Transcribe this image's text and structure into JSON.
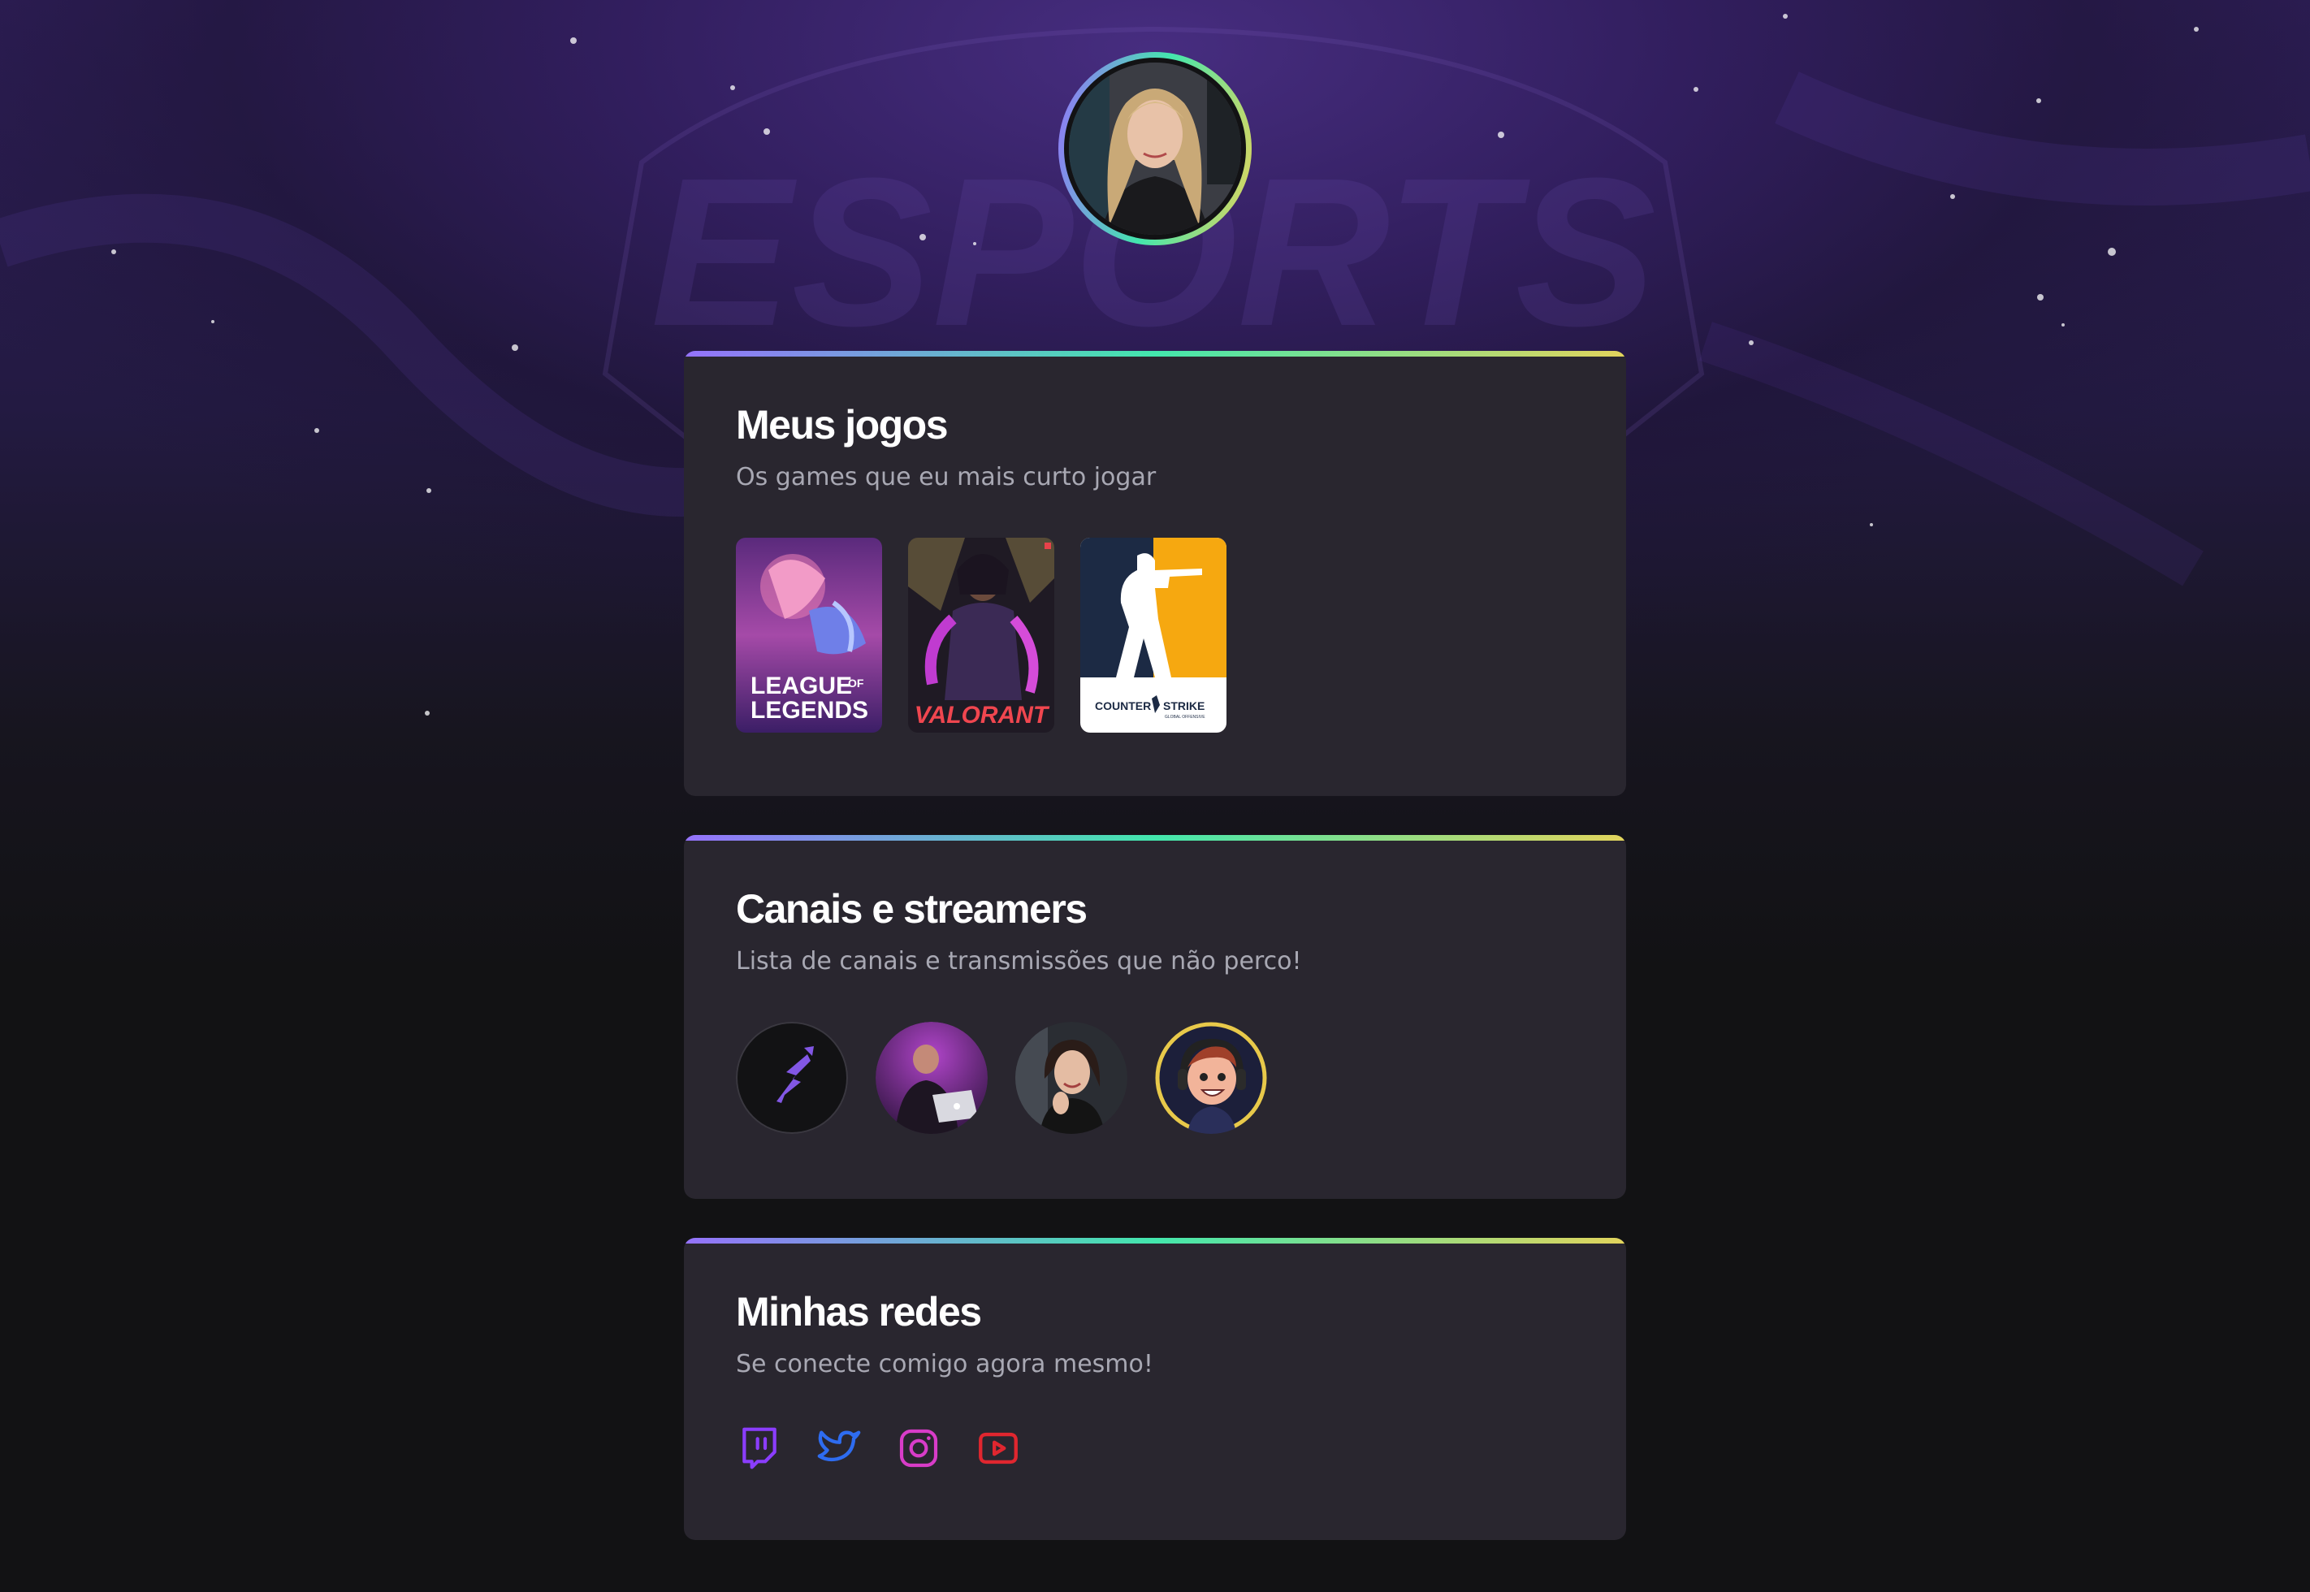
{
  "profile": {
    "avatar_icon": "user-photo",
    "ring_colors": [
      "#9572fc",
      "#43e7ad",
      "#e2d45c"
    ]
  },
  "background": {
    "watermark_text": "ESPORTS"
  },
  "games_card": {
    "title": "Meus jogos",
    "subtitle": "Os games que eu mais curto jogar",
    "games": [
      {
        "label_line1": "LEAGUE",
        "label_small": "OF",
        "label_line2": "LEGENDS",
        "icon": "league-of-legends-cover"
      },
      {
        "label": "VALORANT",
        "icon": "valorant-cover"
      },
      {
        "label_left": "COUNTER",
        "label_right": "STRIKE",
        "label_small": "GLOBAL OFFENSIVE",
        "icon": "counter-strike-cover"
      }
    ]
  },
  "channels_card": {
    "title": "Canais e streamers",
    "subtitle": "Lista de canais e transmissões que não perco!",
    "channels": [
      {
        "icon": "rocketseat-logo-avatar"
      },
      {
        "icon": "streamer-with-laptop-avatar"
      },
      {
        "icon": "streamer-woman-avatar"
      },
      {
        "icon": "cartoon-gamer-avatar"
      }
    ]
  },
  "socials_card": {
    "title": "Minhas redes",
    "subtitle": "Se conecte comigo agora mesmo!",
    "links": [
      {
        "icon": "twitch-icon",
        "color": "#8b3dff"
      },
      {
        "icon": "twitter-icon",
        "color": "#2e6cf0"
      },
      {
        "icon": "instagram-icon",
        "color": "#d83cc8"
      },
      {
        "icon": "youtube-icon",
        "color": "#e0262f"
      }
    ]
  }
}
